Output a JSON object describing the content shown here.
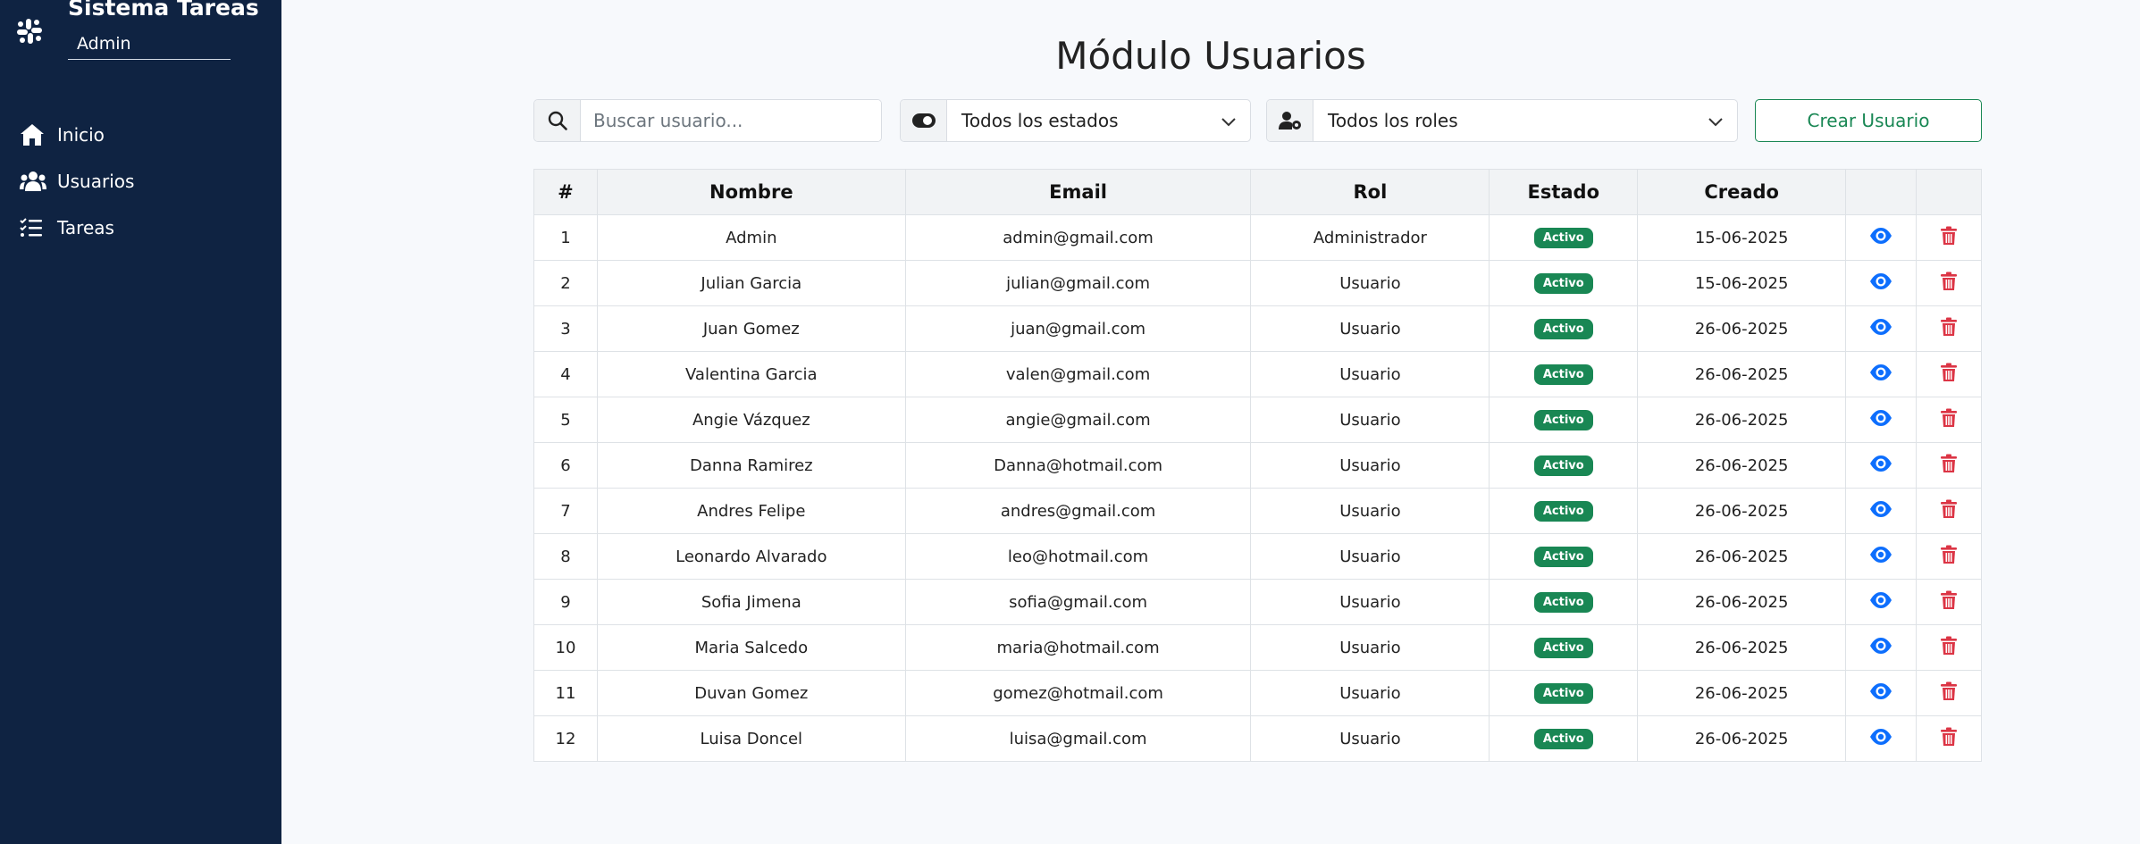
{
  "sidebar": {
    "brand_title": "Sistema Tareas",
    "user_name": "Admin",
    "items": [
      {
        "label": "Inicio",
        "icon": "home-icon"
      },
      {
        "label": "Usuarios",
        "icon": "users-icon"
      },
      {
        "label": "Tareas",
        "icon": "tasks-list-icon"
      }
    ]
  },
  "page": {
    "title": "Módulo Usuarios"
  },
  "toolbar": {
    "search_placeholder": "Buscar usuario...",
    "search_value": "",
    "estado_selected": "Todos los estados",
    "rol_selected": "Todos los roles",
    "crear_label": "Crear Usuario"
  },
  "table": {
    "headers": [
      "#",
      "Nombre",
      "Email",
      "Rol",
      "Estado",
      "Creado",
      "",
      ""
    ],
    "rows": [
      {
        "id": "1",
        "nombre": "Admin",
        "email": "admin@gmail.com",
        "rol": "Administrador",
        "estado": "Activo",
        "creado": "15-06-2025"
      },
      {
        "id": "2",
        "nombre": "Julian Garcia",
        "email": "julian@gmail.com",
        "rol": "Usuario",
        "estado": "Activo",
        "creado": "15-06-2025"
      },
      {
        "id": "3",
        "nombre": "Juan Gomez",
        "email": "juan@gmail.com",
        "rol": "Usuario",
        "estado": "Activo",
        "creado": "26-06-2025"
      },
      {
        "id": "4",
        "nombre": "Valentina Garcia",
        "email": "valen@gmail.com",
        "rol": "Usuario",
        "estado": "Activo",
        "creado": "26-06-2025"
      },
      {
        "id": "5",
        "nombre": "Angie Vázquez",
        "email": "angie@gmail.com",
        "rol": "Usuario",
        "estado": "Activo",
        "creado": "26-06-2025"
      },
      {
        "id": "6",
        "nombre": "Danna Ramirez",
        "email": "Danna@hotmail.com",
        "rol": "Usuario",
        "estado": "Activo",
        "creado": "26-06-2025"
      },
      {
        "id": "7",
        "nombre": "Andres Felipe",
        "email": "andres@gmail.com",
        "rol": "Usuario",
        "estado": "Activo",
        "creado": "26-06-2025"
      },
      {
        "id": "8",
        "nombre": "Leonardo Alvarado",
        "email": "leo@hotmail.com",
        "rol": "Usuario",
        "estado": "Activo",
        "creado": "26-06-2025"
      },
      {
        "id": "9",
        "nombre": "Sofia Jimena",
        "email": "sofia@gmail.com",
        "rol": "Usuario",
        "estado": "Activo",
        "creado": "26-06-2025"
      },
      {
        "id": "10",
        "nombre": "Maria Salcedo",
        "email": "maria@hotmail.com",
        "rol": "Usuario",
        "estado": "Activo",
        "creado": "26-06-2025"
      },
      {
        "id": "11",
        "nombre": "Duvan Gomez",
        "email": "gomez@hotmail.com",
        "rol": "Usuario",
        "estado": "Activo",
        "creado": "26-06-2025"
      },
      {
        "id": "12",
        "nombre": "Luisa Doncel",
        "email": "luisa@gmail.com",
        "rol": "Usuario",
        "estado": "Activo",
        "creado": "26-06-2025"
      }
    ],
    "row_actions": [
      {
        "icon": "eye-icon",
        "color": "#0d6efd"
      },
      {
        "icon": "trash-icon",
        "color": "#dc3545"
      }
    ]
  },
  "colors": {
    "sidebar_bg": "#0f2342",
    "page_bg": "#f7f9fc",
    "success": "#198754",
    "primary": "#0d6efd",
    "danger": "#dc3545"
  }
}
